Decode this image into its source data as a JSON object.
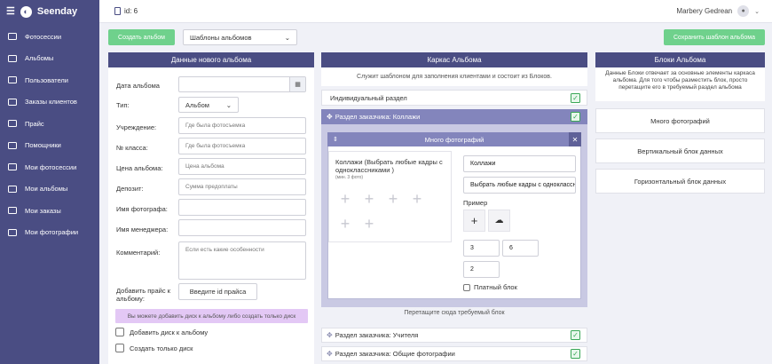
{
  "brand": {
    "name": "Seenday"
  },
  "sidebar": {
    "items": [
      {
        "label": "Фотосессии",
        "icon": "photosessions-icon"
      },
      {
        "label": "Альбомы",
        "icon": "albums-icon"
      },
      {
        "label": "Пользователи",
        "icon": "users-icon"
      },
      {
        "label": "Заказы клиентов",
        "icon": "client-orders-icon"
      },
      {
        "label": "Прайс",
        "icon": "price-icon"
      },
      {
        "label": "Помощники",
        "icon": "helpers-icon"
      },
      {
        "label": "Мои фотосессии",
        "icon": "my-photosessions-icon"
      },
      {
        "label": "Мои альбомы",
        "icon": "my-albums-icon"
      },
      {
        "label": "Мои заказы",
        "icon": "my-orders-icon"
      },
      {
        "label": "Мои фотографии",
        "icon": "my-photos-icon"
      }
    ]
  },
  "topbar": {
    "id_label": "id: 6",
    "user_name": "Marbery Gedrean"
  },
  "toolbar": {
    "create_album": "Создать альбом",
    "templates_select": "Шаблоны альбомов",
    "save_template": "Сохранить шаблон альбома"
  },
  "new_album": {
    "title": "Данные нового альбома",
    "fields": {
      "date": {
        "label": "Дата альбома",
        "value": ""
      },
      "type": {
        "label": "Тип:",
        "value": "Альбом"
      },
      "institution": {
        "label": "Учреждение:",
        "placeholder": "Где была фотосъемка"
      },
      "class_no": {
        "label": "№ класса:",
        "placeholder": "Где была фотосъемка"
      },
      "price": {
        "label": "Цена альбома:",
        "placeholder": "Цена альбома"
      },
      "deposit": {
        "label": "Депозит:",
        "placeholder": "Сумма предоплаты"
      },
      "photographer": {
        "label": "Имя фотографа:",
        "value": ""
      },
      "manager": {
        "label": "Имя менеджера:",
        "value": ""
      },
      "comment": {
        "label": "Комментарий:",
        "placeholder": "Если есть какие особенности"
      },
      "add_price": {
        "label": "Добавить прайс к альбому:",
        "button": "Введите id прайса"
      }
    },
    "info_note": "Вы можете добавить диск к альбому либо создать только диск",
    "add_disk": "Добавить диск к альбому",
    "only_disk": "Создать только диск"
  },
  "skeleton": {
    "title": "Каркас Альбома",
    "subtitle": "Служит шаблоном для заполнения клиентами и состоит из Блоков.",
    "individual": "Индивидуальный раздел",
    "client_section": "Раздел заказчика: Коллажи",
    "block": {
      "title": "Много фотографий",
      "collage_title": "Коллажи (Выбрать любые кадры с одноклассниками )",
      "collage_min": "(мин. 3 фото)",
      "name_value": "Коллажи",
      "desc_value": "Выбрать любые кадры с одноклассн",
      "example_label": "Пример",
      "num1": "3",
      "num2": "6",
      "num3": "2",
      "paid_block": "Платный блок"
    },
    "drop_hint": "Перетащите сюда требуемый блок",
    "section_teachers": "Раздел заказчика: Учителя",
    "section_common": "Раздел заказчика: Общие фотографии"
  },
  "blocks": {
    "title": "Блоки Альбома",
    "desc": "Данные Блоки отвечает за основные элементы каркаса альбома. Для того чтобы разместить блок, просто перетащите его в требуемый раздел альбома",
    "items": [
      "Много фотографий",
      "Вертикальный блок данных",
      "Горизонтальный блок данных"
    ]
  }
}
